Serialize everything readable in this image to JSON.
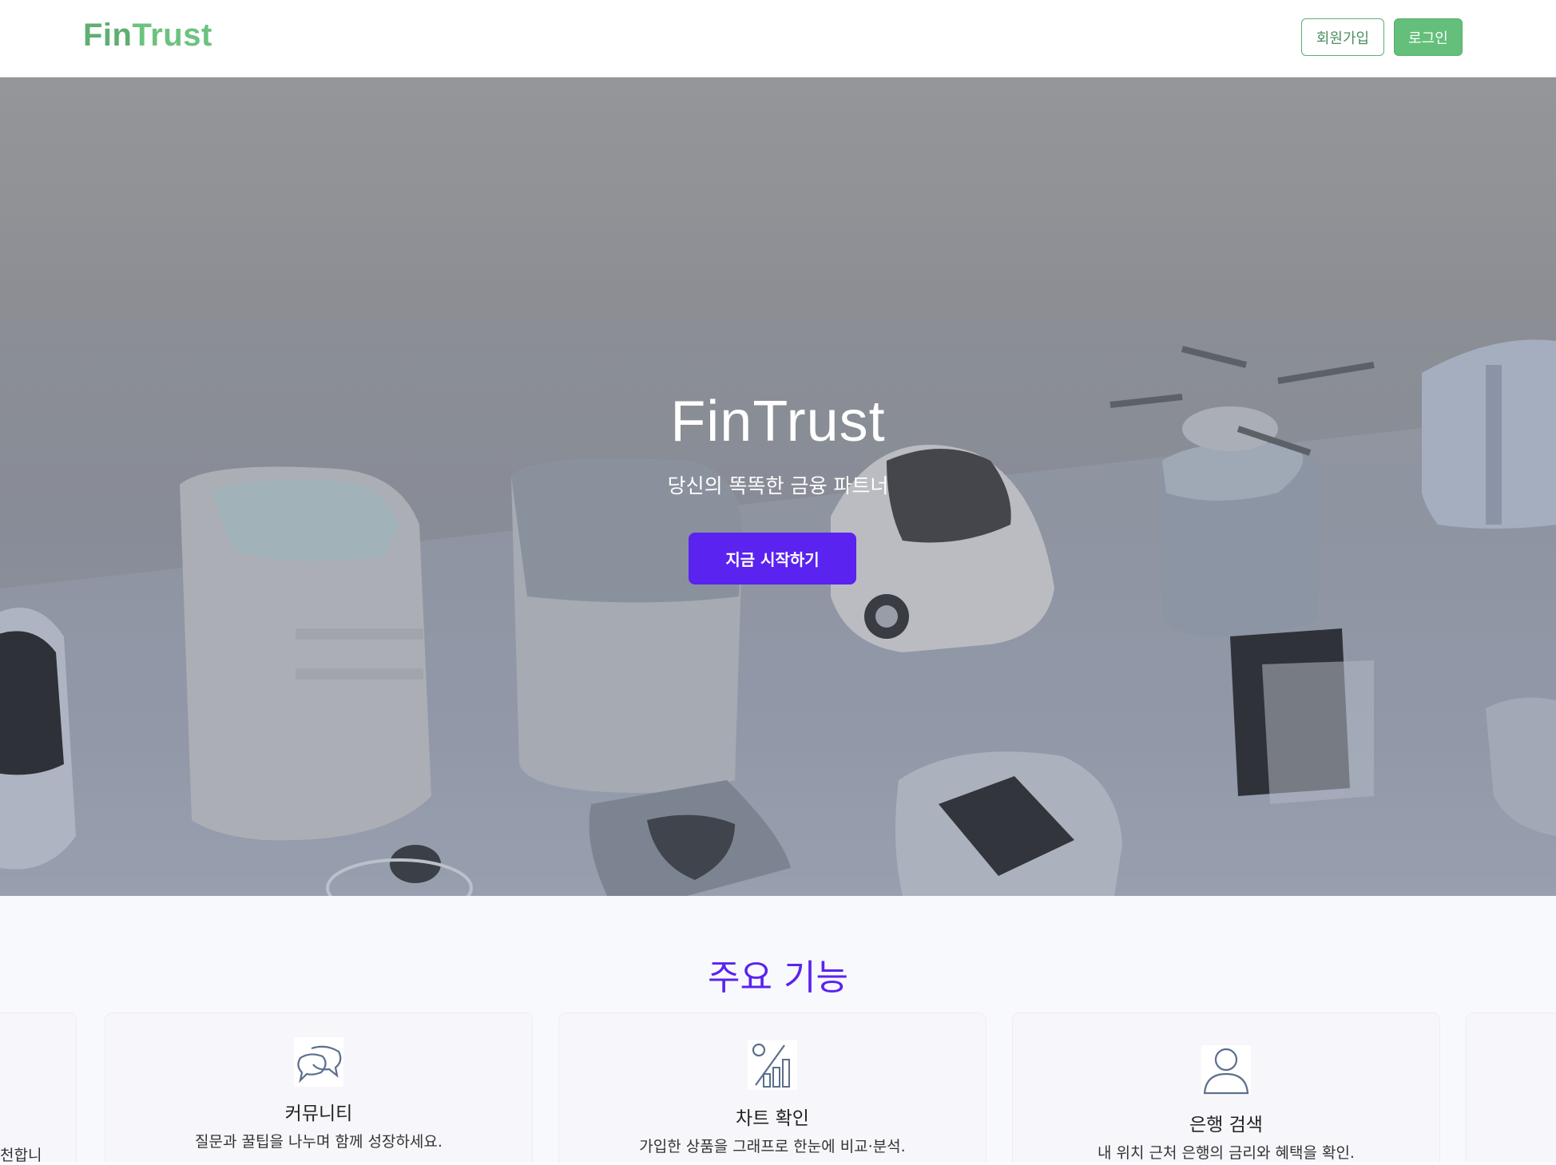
{
  "header": {
    "logo_fin": "Fin",
    "logo_trust": "Trust",
    "signup_label": "회원가입",
    "login_label": "로그인"
  },
  "hero": {
    "title": "FinTrust",
    "subtitle": "당신의 똑똑한 금융 파트너",
    "cta_label": "지금 시작하기"
  },
  "features": {
    "section_title": "주요 기능",
    "partial_left_text": "천합니",
    "cards": [
      {
        "icon": "chat-bubbles-icon",
        "title": "커뮤니티",
        "desc": "질문과 꿀팁을 나누며 함께 성장하세요."
      },
      {
        "icon": "chart-percent-icon",
        "title": "차트 확인",
        "desc": "가입한 상품을 그래프로 한눈에 비교·분석."
      },
      {
        "icon": "user-icon",
        "title": "은행 검색",
        "desc": "내 위치 근처 은행의 금리와 혜택을 확인."
      }
    ]
  },
  "colors": {
    "brand_green": "#5fae73",
    "accent_purple": "#5a23f0"
  }
}
